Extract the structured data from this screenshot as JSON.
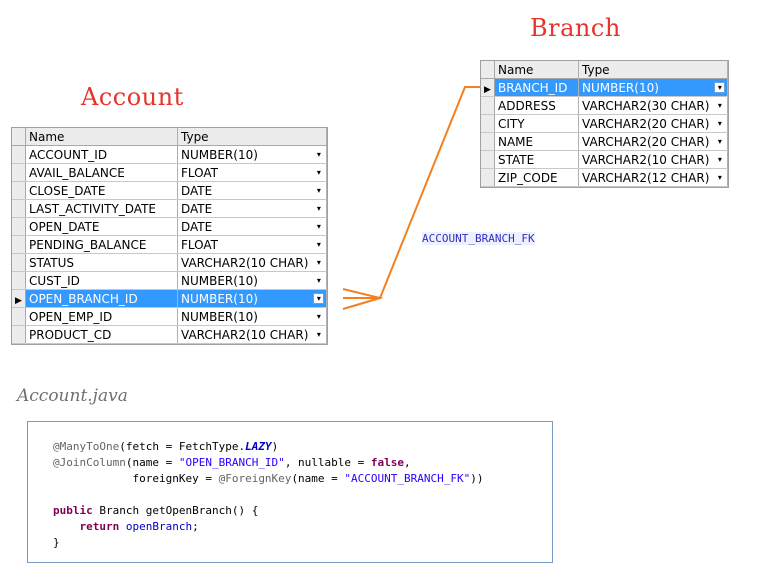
{
  "account": {
    "title": "Account",
    "headers": {
      "name": "Name",
      "type": "Type"
    },
    "columns": [
      {
        "name": "ACCOUNT_ID",
        "type": "NUMBER(10)"
      },
      {
        "name": "AVAIL_BALANCE",
        "type": "FLOAT"
      },
      {
        "name": "CLOSE_DATE",
        "type": "DATE"
      },
      {
        "name": "LAST_ACTIVITY_DATE",
        "type": "DATE"
      },
      {
        "name": "OPEN_DATE",
        "type": "DATE"
      },
      {
        "name": "PENDING_BALANCE",
        "type": "FLOAT"
      },
      {
        "name": "STATUS",
        "type": "VARCHAR2(10 CHAR)"
      },
      {
        "name": "CUST_ID",
        "type": "NUMBER(10)"
      },
      {
        "name": "OPEN_BRANCH_ID",
        "type": "NUMBER(10)"
      },
      {
        "name": "OPEN_EMP_ID",
        "type": "NUMBER(10)"
      },
      {
        "name": "PRODUCT_CD",
        "type": "VARCHAR2(10 CHAR)"
      }
    ],
    "selected_row": 8
  },
  "branch": {
    "title": "Branch",
    "headers": {
      "name": "Name",
      "type": "Type"
    },
    "columns": [
      {
        "name": "BRANCH_ID",
        "type": "NUMBER(10)"
      },
      {
        "name": "ADDRESS",
        "type": "VARCHAR2(30 CHAR)"
      },
      {
        "name": "CITY",
        "type": "VARCHAR2(20 CHAR)"
      },
      {
        "name": "NAME",
        "type": "VARCHAR2(20 CHAR)"
      },
      {
        "name": "STATE",
        "type": "VARCHAR2(10 CHAR)"
      },
      {
        "name": "ZIP_CODE",
        "type": "VARCHAR2(12 CHAR)"
      }
    ],
    "selected_row": 0
  },
  "relationship": {
    "label": "ACCOUNT_BRANCH_FK",
    "color": "#f47f20"
  },
  "code_title": "Account.java",
  "code": {
    "l1_ann": "@ManyToOne",
    "l1_a": "(fetch = FetchType.",
    "l1_b": "LAZY",
    "l1_c": ")",
    "l2_ann": "@JoinColumn",
    "l2_a": "(name = ",
    "l2_str": "\"OPEN_BRANCH_ID\"",
    "l2_b": ", nullable = ",
    "l2_kw": "false",
    "l2_c": ",",
    "l3_a": "            foreignKey = ",
    "l3_ann": "@ForeignKey",
    "l3_b": "(name = ",
    "l3_str": "\"ACCOUNT_BRANCH_FK\"",
    "l3_c": "))",
    "l5_kw": "public",
    "l5_a": " Branch getOpenBranch() {",
    "l6_kw": "return",
    "l6_fld": "openBranch",
    "l6_b": ";",
    "l7": "}"
  },
  "icons": {
    "dropdown": "dropdown-arrow-icon",
    "row_pointer": "row-pointer-icon"
  }
}
